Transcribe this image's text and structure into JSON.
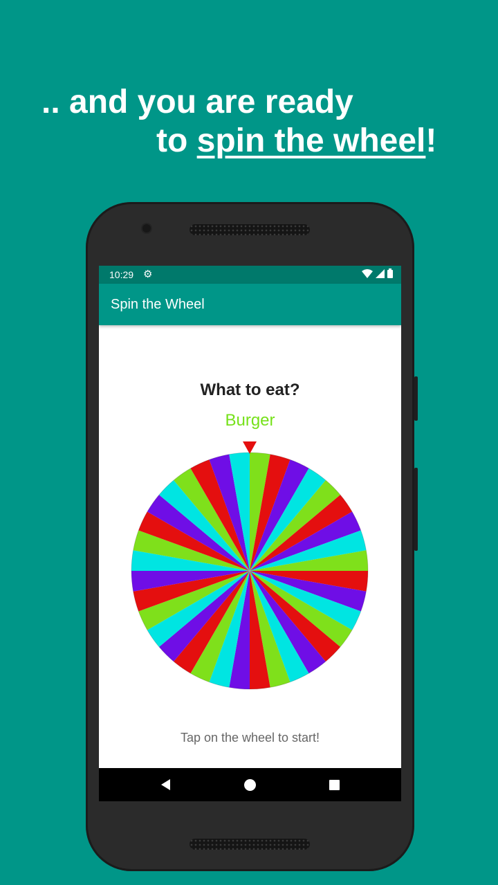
{
  "headline": {
    "line1": ".. and you are ready",
    "line2_prefix": "to ",
    "line2_underlined": "spin the wheel",
    "line2_suffix": "!"
  },
  "status_bar": {
    "time": "10:29",
    "settings_icon": "gear-icon",
    "wifi_icon": "wifi-icon",
    "signal_icon": "cell-signal-icon",
    "battery_icon": "battery-icon"
  },
  "app_bar": {
    "title": "Spin the Wheel"
  },
  "main": {
    "question": "What to eat?",
    "result": "Burger",
    "hint": "Tap on the wheel to start!"
  },
  "wheel": {
    "segment_count": 36,
    "colors": [
      "#7fe01b",
      "#e40f0f",
      "#6f0ee6",
      "#00e5e2"
    ],
    "pointer_color": "#e40f0f"
  },
  "nav_bar": {
    "back_icon": "back-icon",
    "home_icon": "home-icon",
    "recents_icon": "recents-icon"
  },
  "colors": {
    "background": "#009688",
    "app_bar": "#009688",
    "status_bar": "#00796b",
    "result_text": "#76e11a"
  }
}
